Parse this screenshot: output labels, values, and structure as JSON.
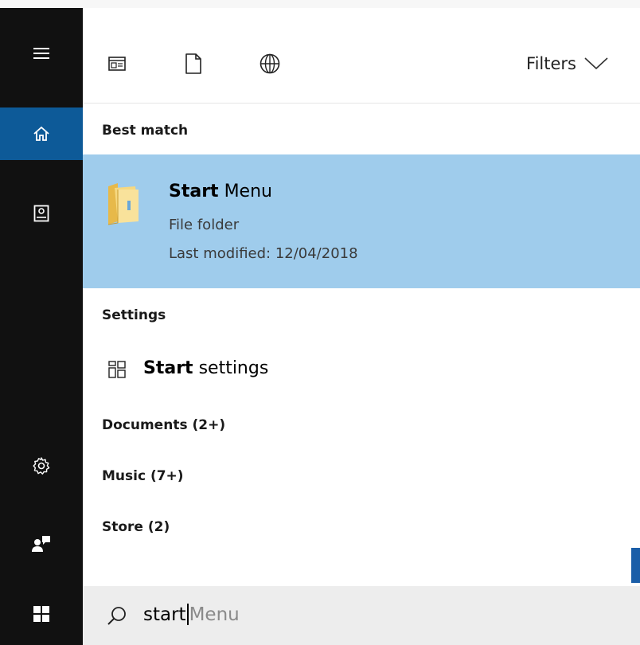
{
  "toolbar": {
    "icons": [
      "apps-icon",
      "document-icon",
      "web-globe-icon"
    ],
    "filters_label": "Filters"
  },
  "rail": {
    "items": [
      "hamburger-menu-icon",
      "home-icon",
      "notebook-icon",
      "settings-gear-icon",
      "user-feedback-icon",
      "windows-start-icon"
    ],
    "active_item": "home-icon"
  },
  "results": {
    "best_match_header": "Best match",
    "best_match": {
      "title_bold": "Start",
      "title_rest": " Menu",
      "type": "File folder",
      "modified": "Last modified: 12/04/2018"
    },
    "settings_header": "Settings",
    "setting_item": {
      "title_bold": "Start",
      "title_rest": " settings"
    },
    "categories": [
      "Documents (2+)",
      "Music (7+)",
      "Store (2)"
    ]
  },
  "search": {
    "typed": "start",
    "suggestion": " Menu"
  },
  "colors": {
    "rail_bg": "#111111",
    "rail_active": "#0d5a98",
    "highlight": "#9fccec",
    "search_bg": "#ededed"
  }
}
